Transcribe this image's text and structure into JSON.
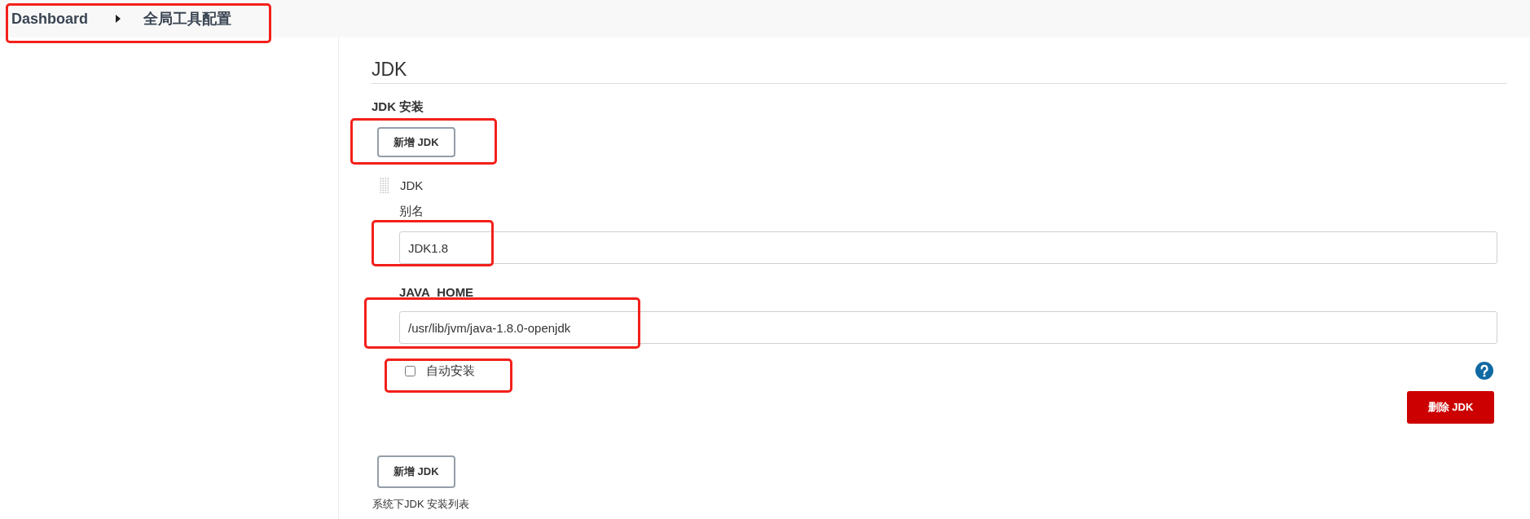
{
  "breadcrumb": {
    "highlighted": true,
    "items": [
      {
        "label": "Dashboard"
      },
      {
        "label": "全局工具配置"
      }
    ]
  },
  "jdk_section": {
    "title": "JDK",
    "install_label": "JDK 安装",
    "add_button": {
      "label": "新增 JDK",
      "highlighted": true
    },
    "installations": [
      {
        "title": "JDK",
        "fields": [
          {
            "label": "别名",
            "value": "JDK1.8",
            "highlighted": true
          },
          {
            "label": "JAVA_HOME",
            "value": "/usr/lib/jvm/java-1.8.0-openjdk",
            "highlighted": true
          }
        ],
        "auto_install": {
          "label": "自动安装",
          "checked": false,
          "highlighted": true
        },
        "delete_button": {
          "label": "删除 JDK"
        }
      }
    ],
    "add_button_bottom": {
      "label": "新增 JDK"
    },
    "description": "系统下JDK 安装列表"
  }
}
